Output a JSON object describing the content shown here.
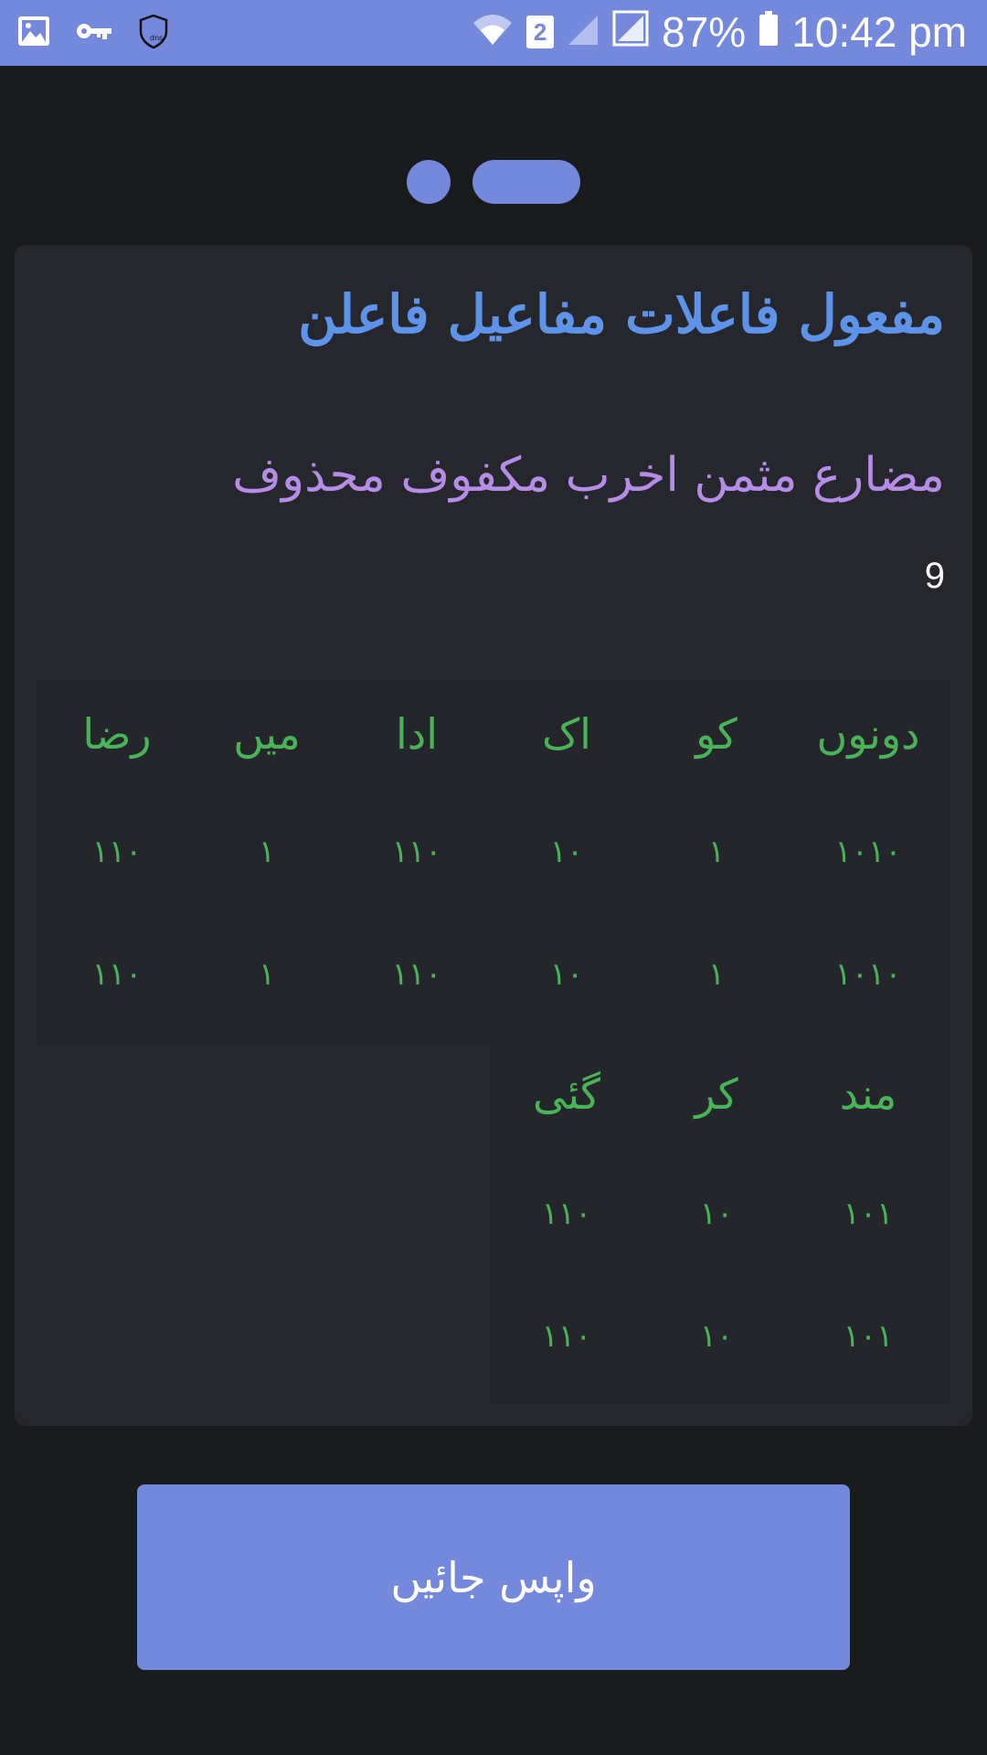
{
  "status_bar": {
    "left_icons": [
      "image-icon",
      "key-icon",
      "dns-shield-icon"
    ],
    "sim_badge": "2",
    "battery_percent": "87%",
    "time": "10:42 pm"
  },
  "pager": {
    "pages": 2,
    "active_index": 1
  },
  "card": {
    "meter": "مفعول فاعلات مفاعیل فاعلن",
    "bahr": "مضارع مثمن اخرب مکفوف محذوف",
    "verse_number": "9",
    "line1": {
      "words": [
        "دونوں",
        "کو",
        "اک",
        "ادا",
        "میں",
        "رضا"
      ],
      "scansion_a": [
        "۱۰۱۰",
        "۱",
        "۱۰",
        "۱۱۰",
        "۱",
        "۱۱۰"
      ],
      "scansion_b": [
        "۱۰۱۰",
        "۱",
        "۱۰",
        "۱۱۰",
        "۱",
        "۱۱۰"
      ]
    },
    "line2": {
      "words": [
        "مند",
        "کر",
        "گئی"
      ],
      "scansion_a": [
        "۱۰۱",
        "۱۰",
        "۱۱۰"
      ],
      "scansion_b": [
        "۱۰۱",
        "۱۰",
        "۱۱۰"
      ]
    }
  },
  "back_button": {
    "label": "واپس جائیں"
  },
  "colors": {
    "accent": "#7489dc",
    "background": "#1a1b1d",
    "card": "#26262d",
    "meter": "#5e93ea",
    "bahr": "#b58ce6",
    "words": "#49b357"
  }
}
